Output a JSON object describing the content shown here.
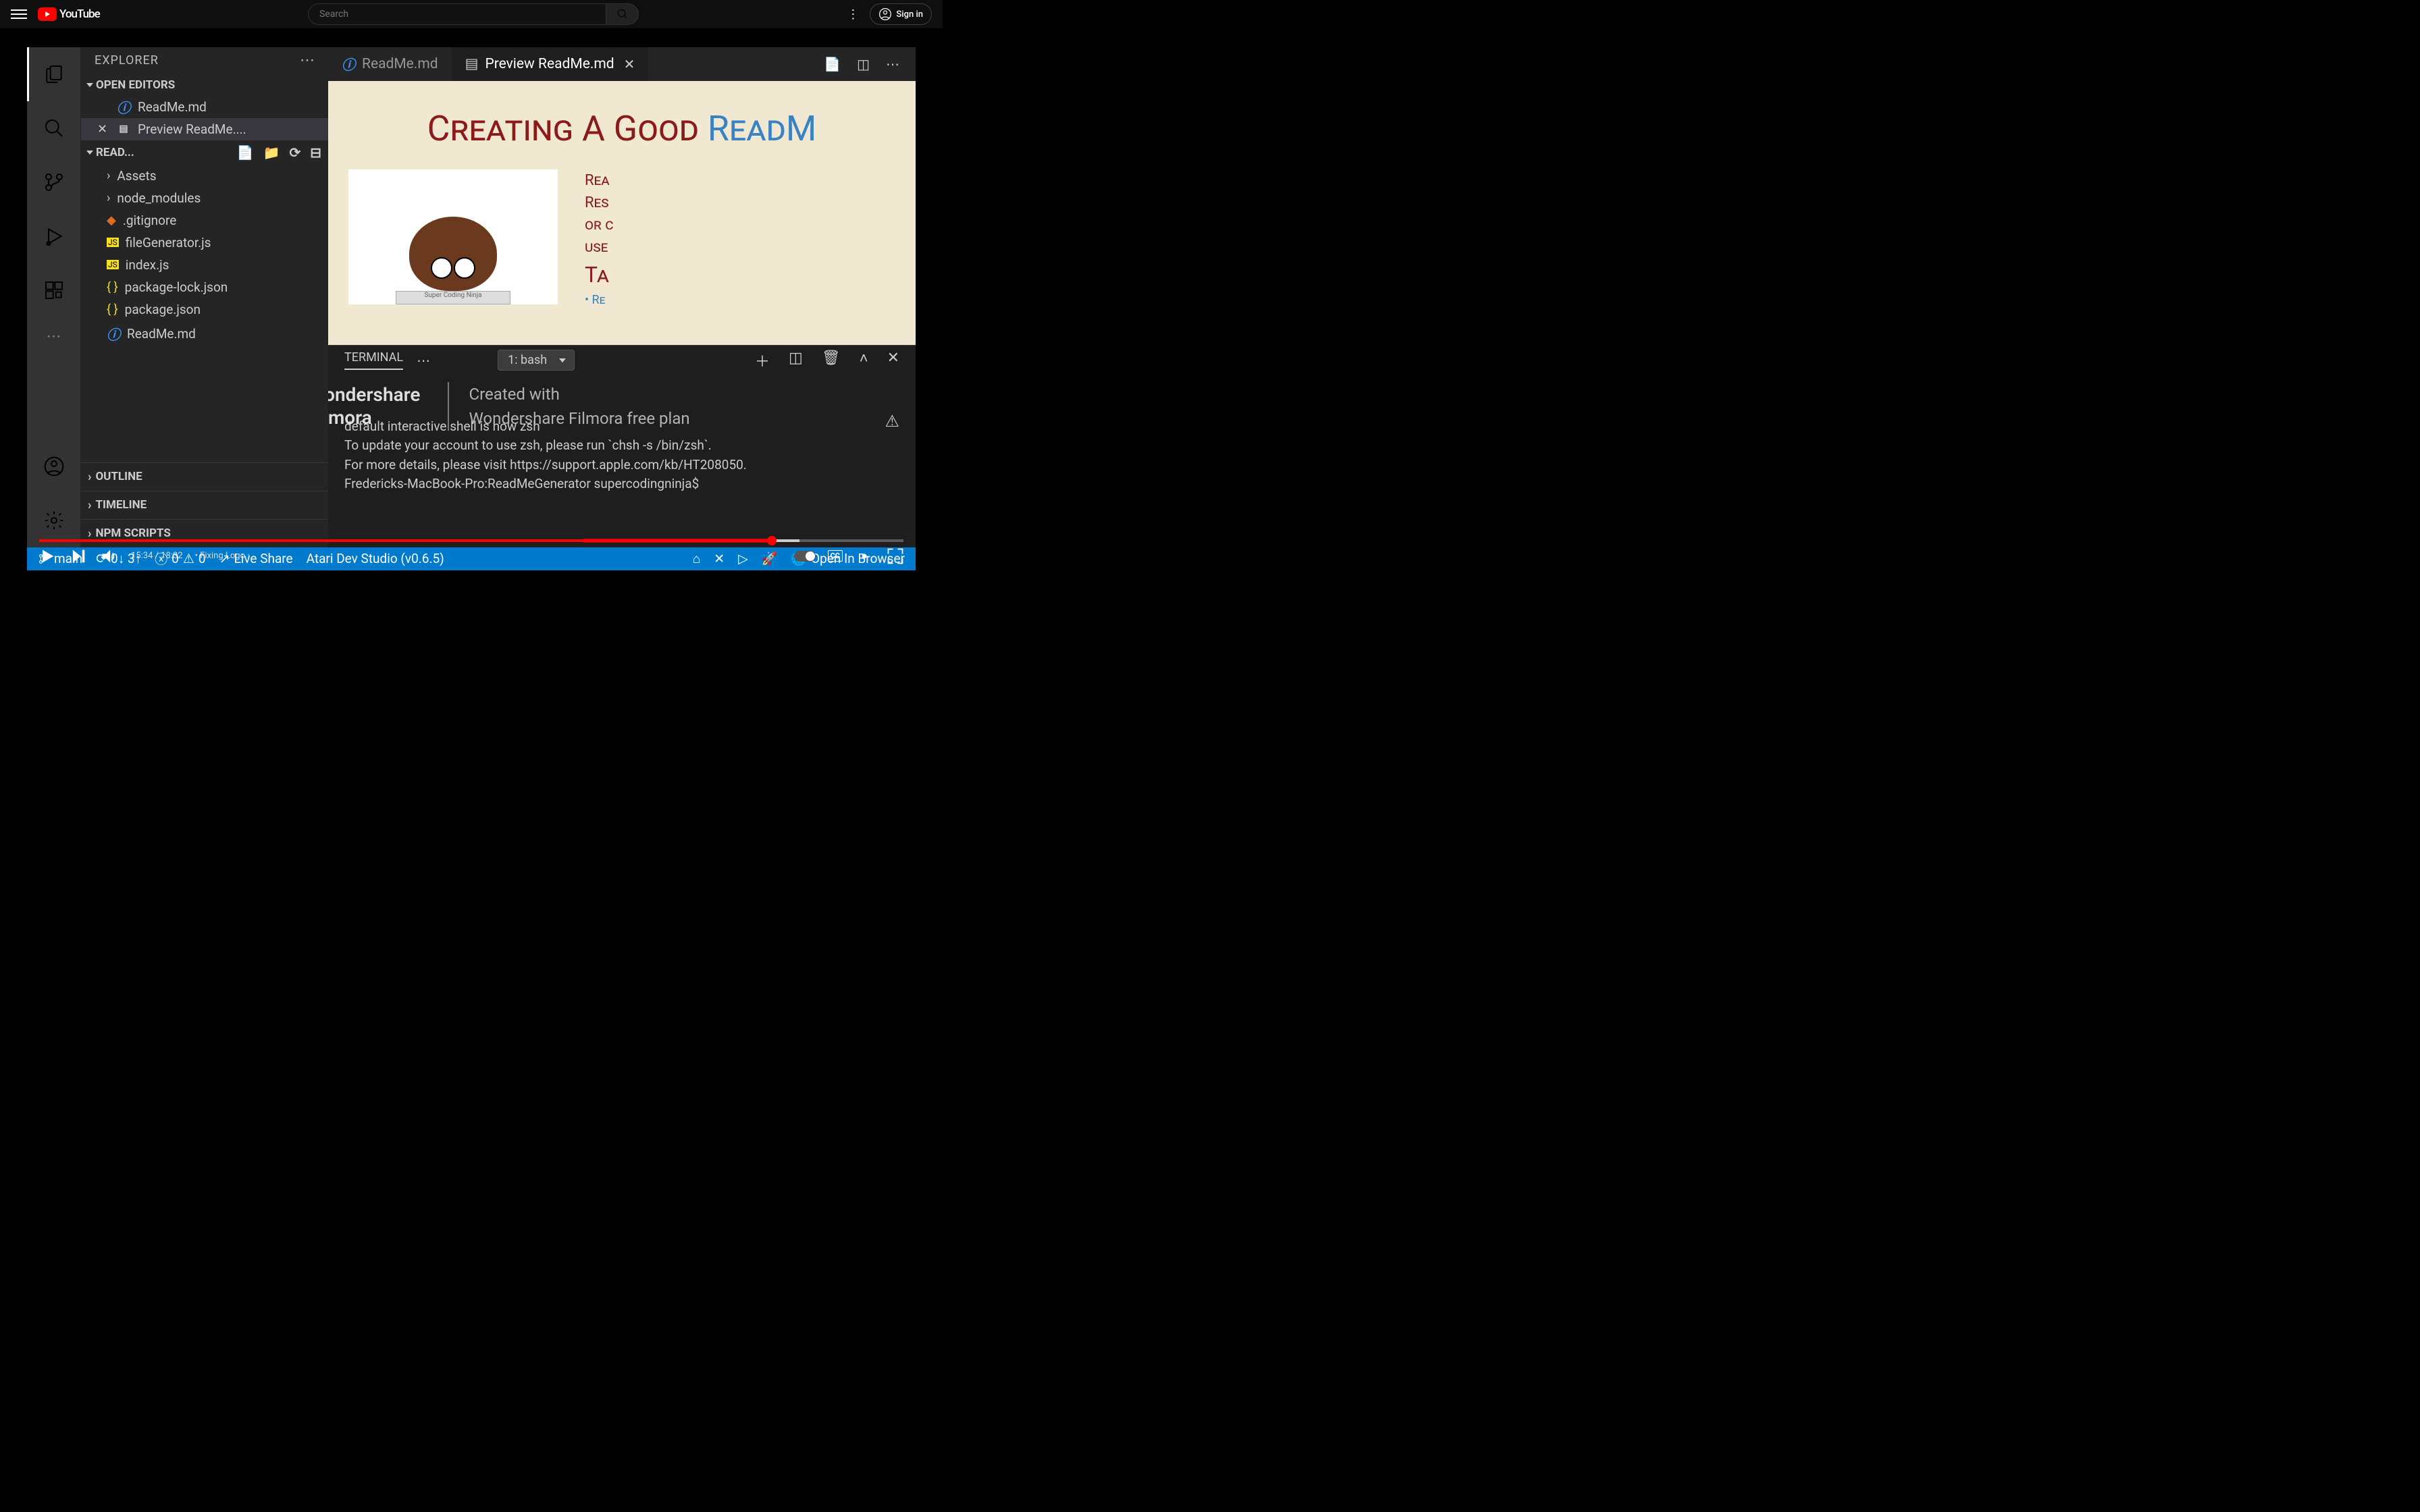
{
  "youtube": {
    "logo_text": "YouTube",
    "search_placeholder": "Search",
    "signin": "Sign in"
  },
  "vscode": {
    "sidebar_title": "EXPLORER",
    "sections": {
      "open_editors": "OPEN EDITORS",
      "project": "READ...",
      "outline": "OUTLINE",
      "timeline": "TIMELINE",
      "npm": "NPM SCRIPTS"
    },
    "open_editors": [
      {
        "name": "ReadMe.md",
        "icon": "info"
      },
      {
        "name": "Preview ReadMe....",
        "icon": "preview",
        "active": true
      }
    ],
    "files": [
      {
        "name": "Assets",
        "icon": "folder"
      },
      {
        "name": "node_modules",
        "icon": "folder"
      },
      {
        "name": ".gitignore",
        "icon": "git"
      },
      {
        "name": "fileGenerator.js",
        "icon": "js"
      },
      {
        "name": "index.js",
        "icon": "js"
      },
      {
        "name": "package-lock.json",
        "icon": "json"
      },
      {
        "name": "package.json",
        "icon": "json"
      },
      {
        "name": "ReadMe.md",
        "icon": "info"
      }
    ],
    "tabs": [
      {
        "label": "ReadMe.md",
        "icon": "info"
      },
      {
        "label": "Preview ReadMe.md",
        "icon": "preview",
        "active": true,
        "closable": true
      }
    ],
    "preview": {
      "title_a": "Creating A Good ",
      "title_b": "ReadM",
      "side1": "Rea",
      "side2": "Res",
      "side3": "or c",
      "side4": "use",
      "side_big": "Ta",
      "bullet": "• Re",
      "laptop": "Super Coding Ninja"
    },
    "terminal": {
      "tab": "TERMINAL",
      "shell": "1: bash",
      "wm_brand": "Wondershare\nFilmora",
      "wm_created": "Created with",
      "wm_plan": "Wondershare Filmora free plan",
      "line1": "default interactive shell is now zsh",
      "line2": "To update your account to use zsh, please run `chsh -s /bin/zsh`.",
      "line3": "For more details, please visit https://support.apple.com/kb/HT208050.",
      "prompt": "Fredericks-MacBook-Pro:ReadMeGenerator supercodingninja$"
    },
    "statusbar": {
      "branch": "main",
      "sync": "0↓ 3↑",
      "errors": "0",
      "warnings": "0",
      "liveshare": "Live Share",
      "atari": "Atari Dev Studio (v0.6.5)",
      "open_browser": "Open In Browser"
    }
  },
  "player": {
    "current": "15:34",
    "total": "18:32",
    "chapter": "Fixing Logo"
  }
}
